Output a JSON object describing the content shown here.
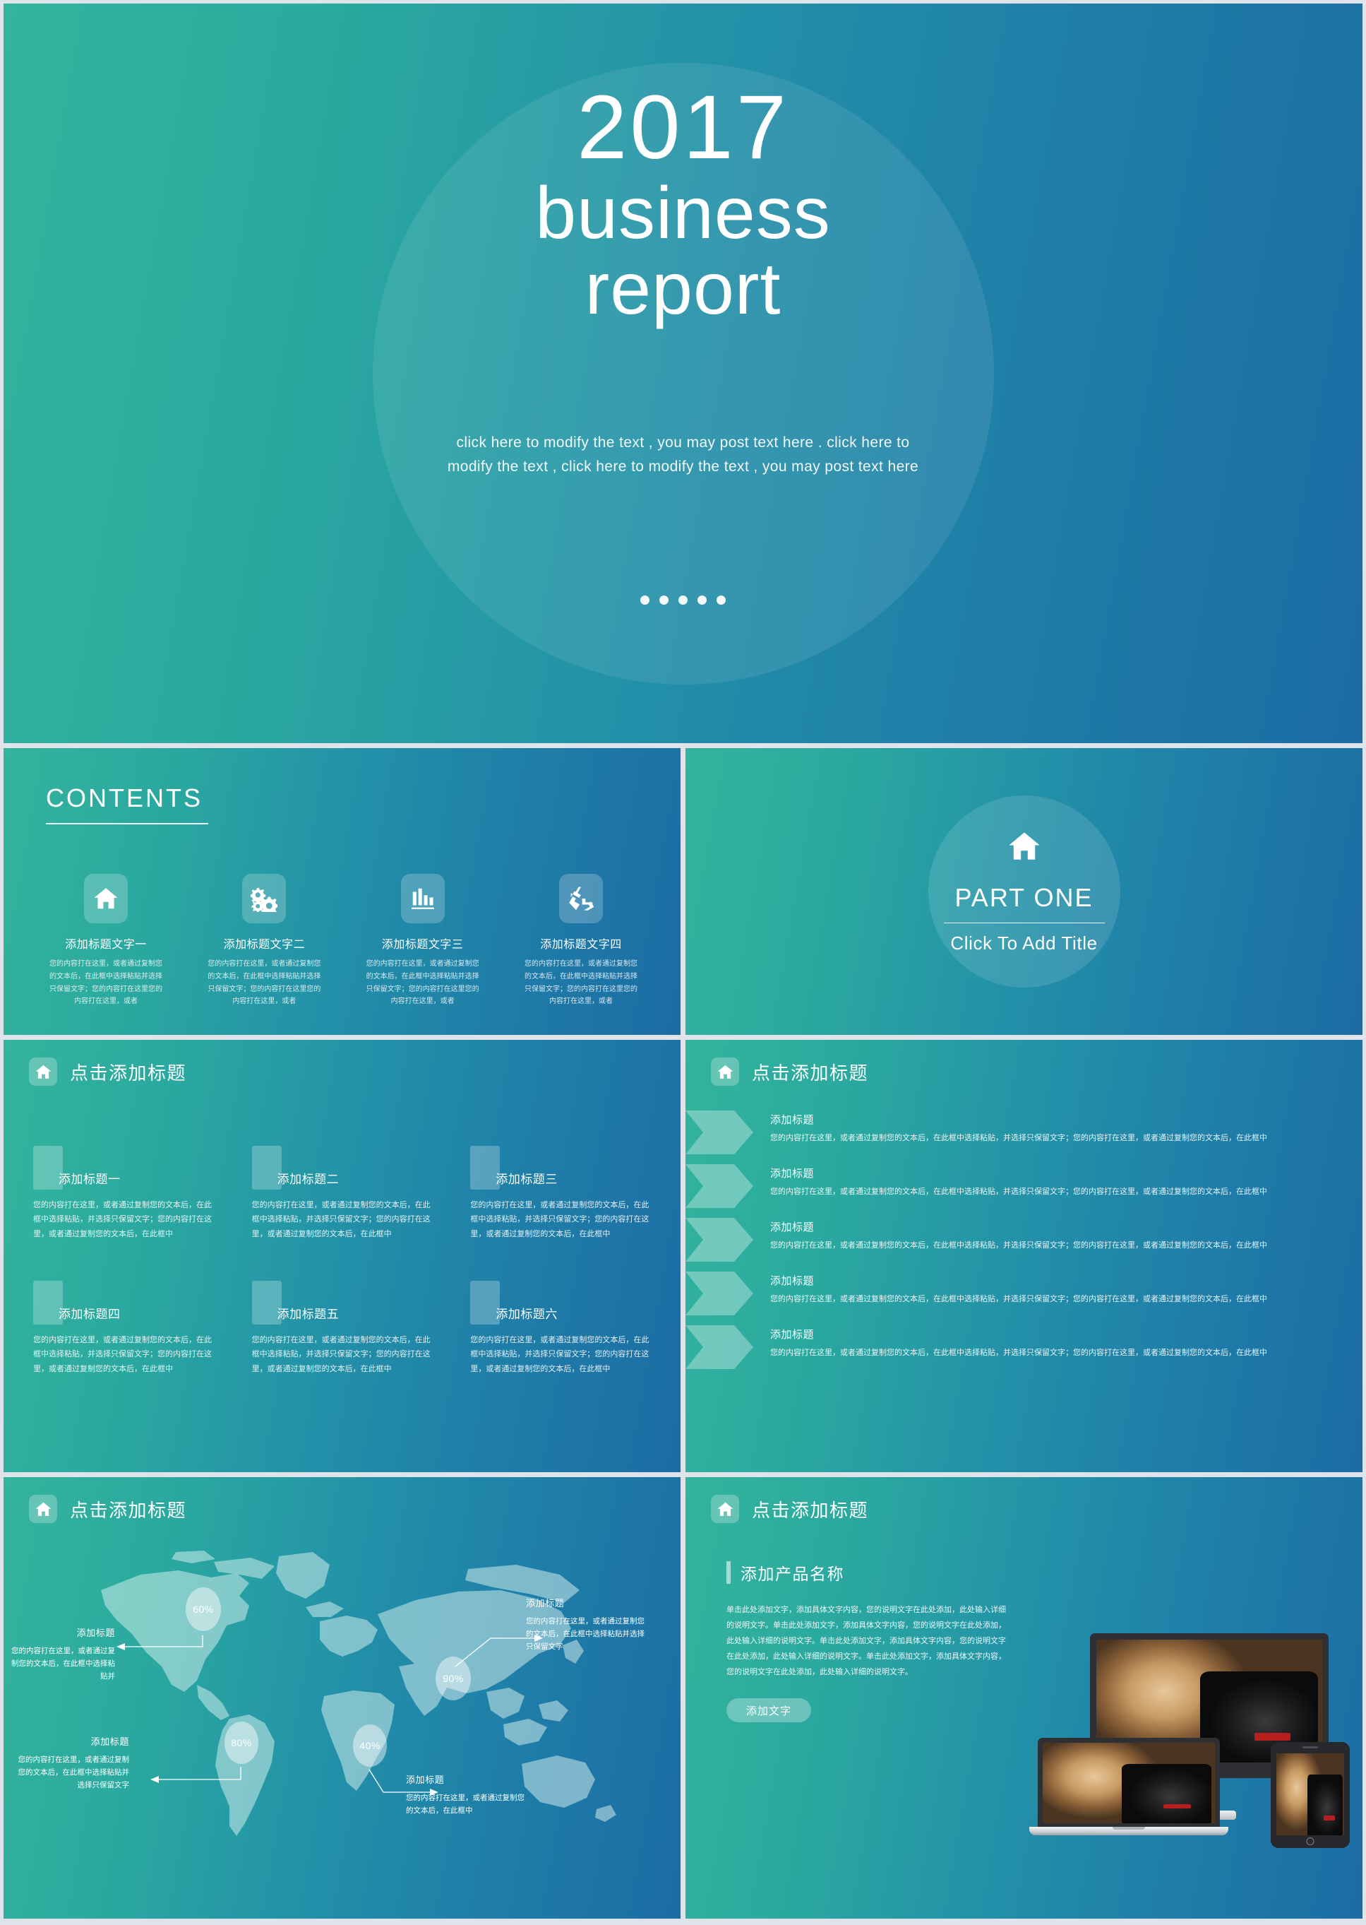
{
  "theme": {
    "gradient_start": "#33b49c",
    "gradient_end": "#1c6ca4",
    "gap_color": "#dfe3ea",
    "text_color": "#ffffff"
  },
  "cover": {
    "year": "2017",
    "word1": "business",
    "word2": "report",
    "subtitle": "click here to modify the text , you may post text here . click here to modify the text , click here to modify the text , you may post text here",
    "dots": 5
  },
  "contents": {
    "heading": "CONTENTS",
    "cards": [
      {
        "icon": "home-icon",
        "title": "添加标题文字一",
        "body": "您的内容打在这里，或者通过复制您的文本后，在此框中选择粘贴并选择只保留文字；您的内容打在这里您的内容打在这里，或者"
      },
      {
        "icon": "gears-icon",
        "title": "添加标题文字二",
        "body": "您的内容打在这里，或者通过复制您的文本后，在此框中选择粘贴并选择只保留文字；您的内容打在这里您的内容打在这里，或者"
      },
      {
        "icon": "bar-chart-icon",
        "title": "添加标题文字三",
        "body": "您的内容打在这里，或者通过复制您的文本后，在此框中选择粘贴并选择只保留文字；您的内容打在这里您的内容打在这里，或者"
      },
      {
        "icon": "recycle-icon",
        "title": "添加标题文字四",
        "body": "您的内容打在这里，或者通过复制您的文本后，在此框中选择粘贴并选择只保留文字；您的内容打在这里您的内容打在这里，或者"
      }
    ]
  },
  "section": {
    "icon": "home-icon",
    "part_label": "PART ONE",
    "subtitle": "Click To Add Title"
  },
  "grid_slide": {
    "header_icon": "home-icon",
    "header_title": "点击添加标题",
    "items": [
      {
        "title": "添加标题一",
        "body": "您的内容打在这里，或者通过复制您的文本后，在此框中选择粘贴，并选择只保留文字；您的内容打在这里，或者通过复制您的文本后，在此框中"
      },
      {
        "title": "添加标题二",
        "body": "您的内容打在这里，或者通过复制您的文本后，在此框中选择粘贴，并选择只保留文字；您的内容打在这里，或者通过复制您的文本后，在此框中"
      },
      {
        "title": "添加标题三",
        "body": "您的内容打在这里，或者通过复制您的文本后，在此框中选择粘贴，并选择只保留文字；您的内容打在这里，或者通过复制您的文本后，在此框中"
      },
      {
        "title": "添加标题四",
        "body": "您的内容打在这里，或者通过复制您的文本后，在此框中选择粘贴，并选择只保留文字；您的内容打在这里，或者通过复制您的文本后，在此框中"
      },
      {
        "title": "添加标题五",
        "body": "您的内容打在这里，或者通过复制您的文本后，在此框中选择粘贴，并选择只保留文字；您的内容打在这里，或者通过复制您的文本后，在此框中"
      },
      {
        "title": "添加标题六",
        "body": "您的内容打在这里，或者通过复制您的文本后，在此框中选择粘贴，并选择只保留文字；您的内容打在这里，或者通过复制您的文本后，在此框中"
      }
    ]
  },
  "arrow_slide": {
    "header_icon": "home-icon",
    "header_title": "点击添加标题",
    "items": [
      {
        "title": "添加标题",
        "body": "您的内容打在这里，或者通过复制您的文本后，在此框中选择粘贴，并选择只保留文字；您的内容打在这里，或者通过复制您的文本后，在此框中"
      },
      {
        "title": "添加标题",
        "body": "您的内容打在这里，或者通过复制您的文本后，在此框中选择粘贴，并选择只保留文字；您的内容打在这里，或者通过复制您的文本后，在此框中"
      },
      {
        "title": "添加标题",
        "body": "您的内容打在这里，或者通过复制您的文本后，在此框中选择粘贴，并选择只保留文字；您的内容打在这里，或者通过复制您的文本后，在此框中"
      },
      {
        "title": "添加标题",
        "body": "您的内容打在这里，或者通过复制您的文本后，在此框中选择粘贴，并选择只保留文字；您的内容打在这里，或者通过复制您的文本后，在此框中"
      },
      {
        "title": "添加标题",
        "body": "您的内容打在这里，或者通过复制您的文本后，在此框中选择粘贴，并选择只保留文字；您的内容打在这里，或者通过复制您的文本后，在此框中"
      }
    ]
  },
  "map_slide": {
    "header_icon": "home-icon",
    "header_title": "点击添加标题",
    "bubbles": [
      {
        "region": "north-america",
        "value": "60%"
      },
      {
        "region": "asia",
        "value": "90%"
      },
      {
        "region": "south-america",
        "value": "80%"
      },
      {
        "region": "africa",
        "value": "40%"
      }
    ],
    "labels": [
      {
        "title": "添加标题",
        "body": "您的内容打在这里，或者通过复制您的文本后，在此框中选择粘贴并"
      },
      {
        "title": "添加标题",
        "body": "您的内容打在这里，或者通过复制您的文本后，在此框中选择粘贴并选择只保留文字"
      },
      {
        "title": "添加标题",
        "body": "您的内容打在这里，或者通过复制您的文本后，在此框中选择粘贴并选择只保留文字"
      },
      {
        "title": "添加标题",
        "body": "您的内容打在这里，或者通过复制您的文本后，在此框中"
      }
    ]
  },
  "product_slide": {
    "header_icon": "home-icon",
    "header_title": "点击添加标题",
    "product_title": "添加产品名称",
    "body": "单击此处添加文字，添加具体文字内容，您的说明文字在此处添加，此处输入详细的说明文字。单击此处添加文字，添加具体文字内容，您的说明文字在此处添加，此处输入详细的说明文字。单击此处添加文字，添加具体文字内容，您的说明文字在此处添加，此处输入详细的说明文字。单击此处添加文字，添加具体文字内容，您的说明文字在此处添加，此处输入详细的说明文字。",
    "button_label": "添加文字",
    "devices": [
      "monitor",
      "laptop",
      "tablet"
    ]
  }
}
